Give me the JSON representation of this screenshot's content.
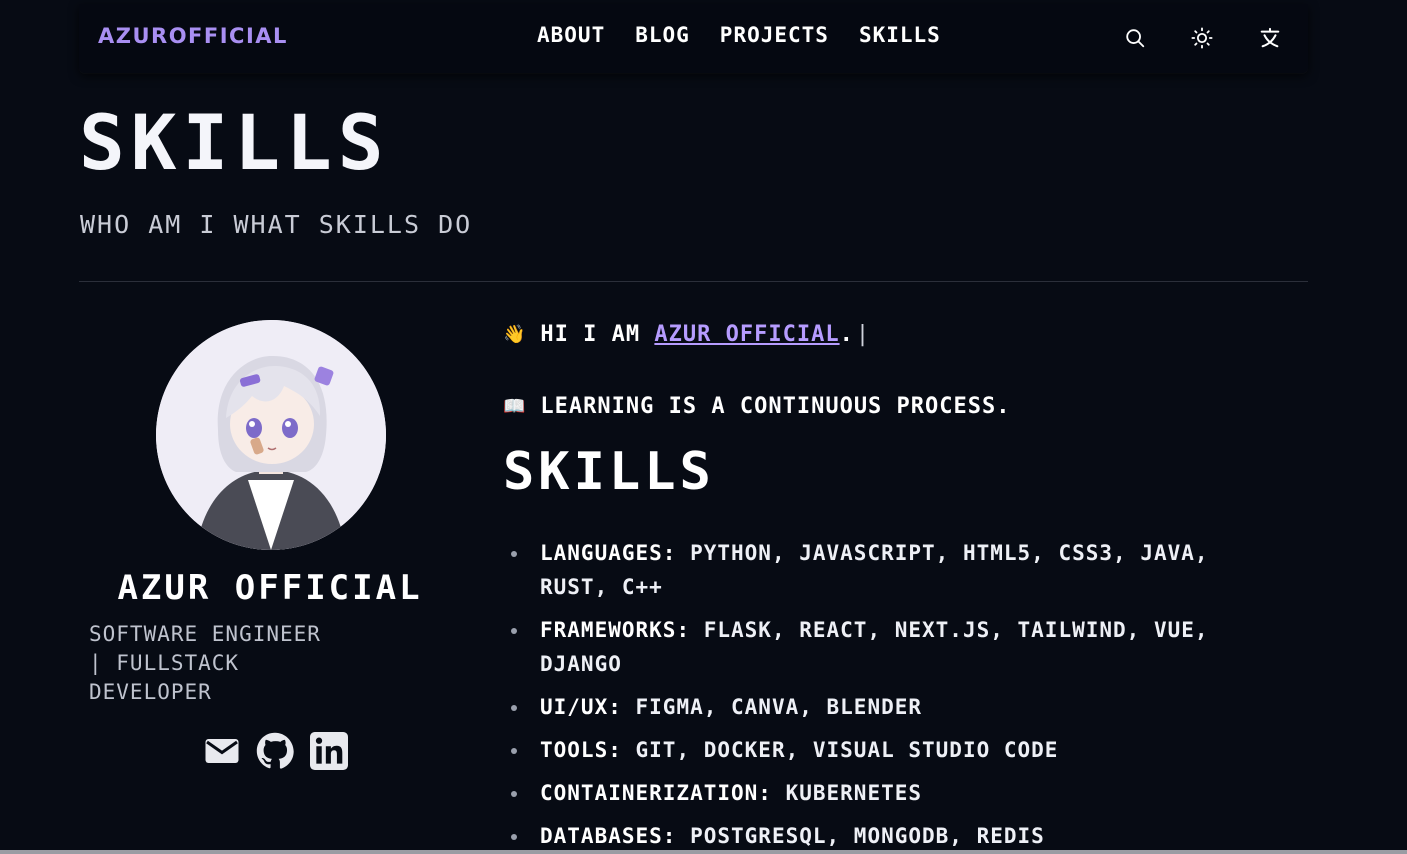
{
  "nav": {
    "brand": "AZUROFFICIAL",
    "links": [
      {
        "label": "ABOUT"
      },
      {
        "label": "BLOG"
      },
      {
        "label": "PROJECTS"
      },
      {
        "label": "SKILLS"
      }
    ],
    "icons": [
      "search-icon",
      "sun-icon",
      "language-icon"
    ]
  },
  "header": {
    "title": "SKILLS",
    "subtitle": "WHO AM I WHAT SKILLS DO"
  },
  "profile": {
    "name": "AZUR OFFICIAL",
    "role_line1": "SOFTWARE ENGINEER",
    "role_line2": "| FULLSTACK",
    "role_line3": "DEVELOPER",
    "social_icons": [
      "mail-icon",
      "github-icon",
      "linkedin-icon"
    ]
  },
  "bio": {
    "line1_emoji": "👋",
    "line1_prefix": "HI I AM",
    "line1_link": "AZUR OFFICIAL",
    "line1_suffix": ".",
    "cursor": "|",
    "line2_emoji": "📖",
    "line2_text": "LEARNING IS A CONTINUOUS PROCESS."
  },
  "skills": {
    "title": "SKILLS",
    "items": [
      {
        "label": "LANGUAGES",
        "value": "PYTHON, JAVASCRIPT, HTML5, CSS3, JAVA, RUST, C++"
      },
      {
        "label": "FRAMEWORKS",
        "value": "FLASK, REACT, NEXT.JS, TAILWIND, VUE, DJANGO"
      },
      {
        "label": "UI/UX",
        "value": "FIGMA, CANVA, BLENDER"
      },
      {
        "label": "TOOLS",
        "value": "GIT, DOCKER, VISUAL STUDIO CODE"
      },
      {
        "label": "CONTAINERIZATION",
        "value": "KUBERNETES"
      },
      {
        "label": "DATABASES",
        "value": "POSTGRESQL, MONGODB, REDIS"
      }
    ]
  },
  "colors": {
    "background": "#070b14",
    "accent": "#a98ff2",
    "link": "#b69cff",
    "text": "#ffffff"
  }
}
